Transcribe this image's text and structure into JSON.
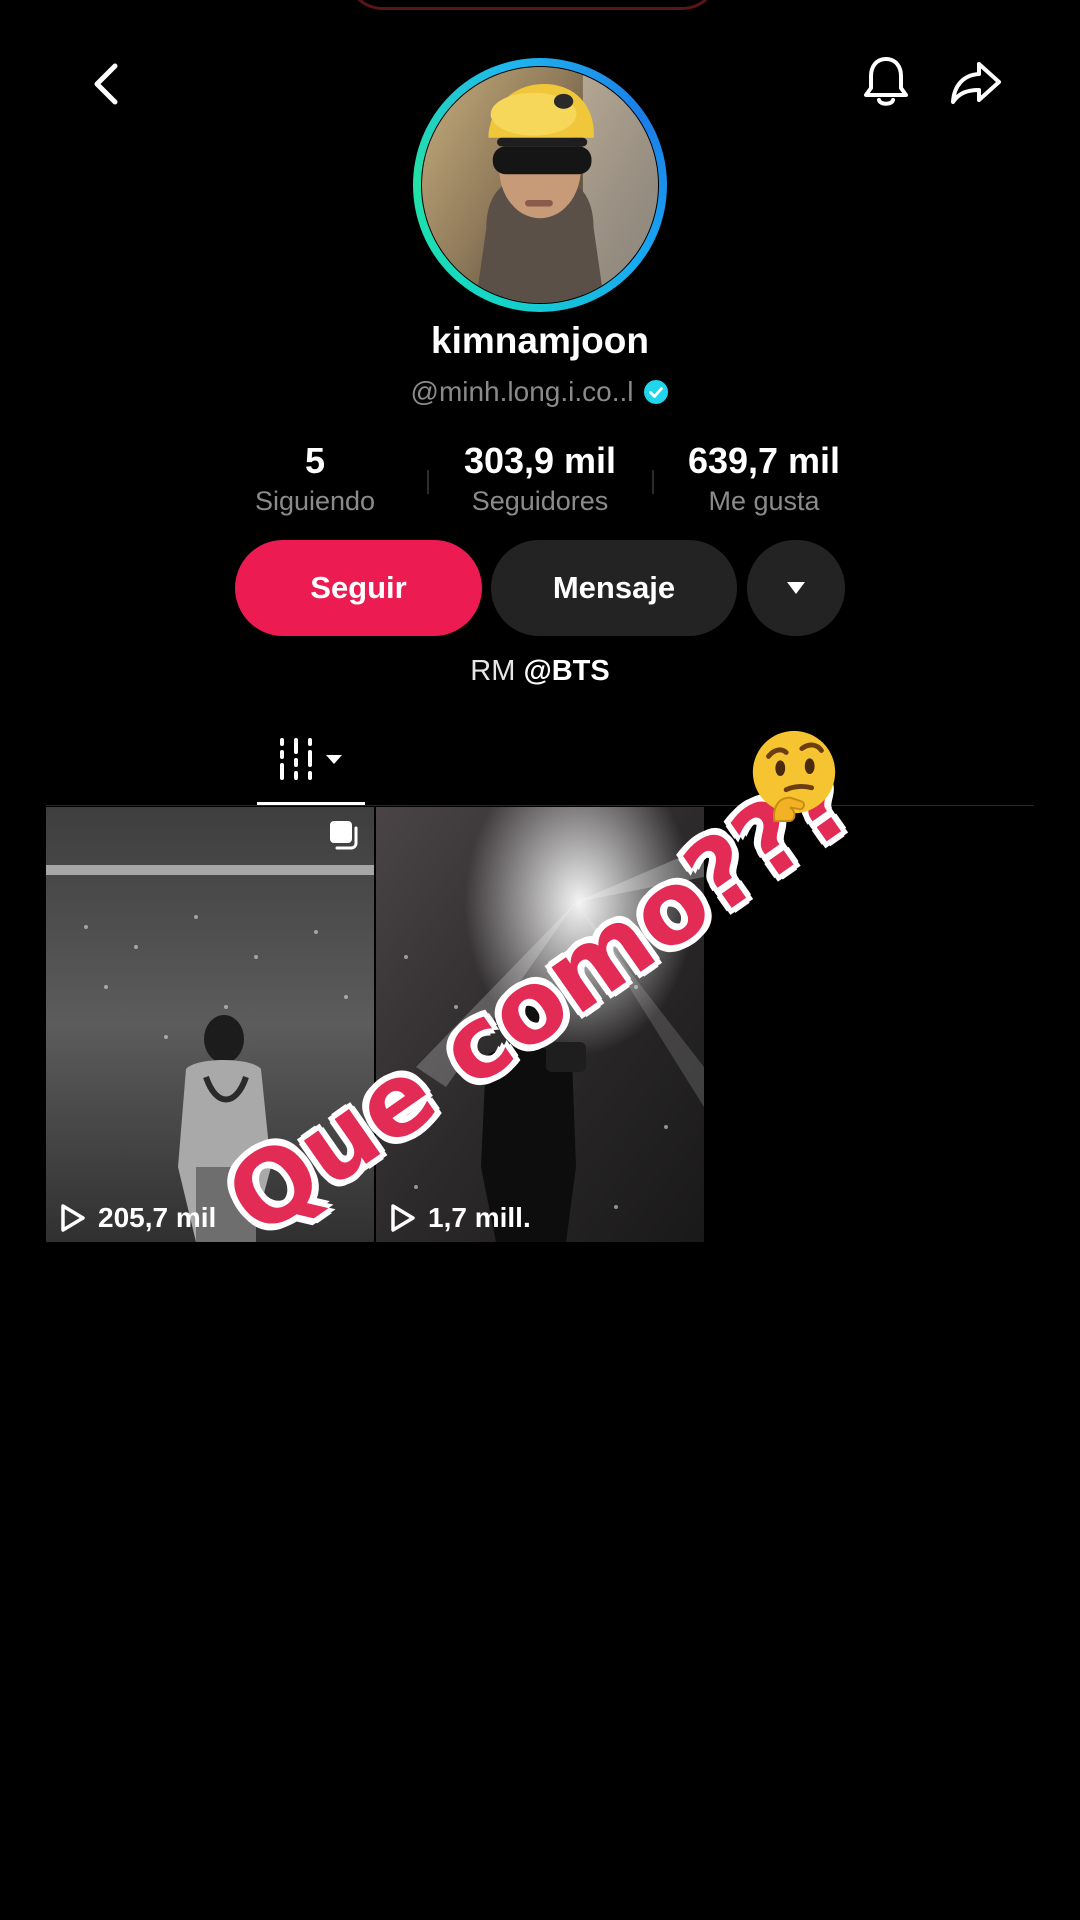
{
  "profile": {
    "display_name": "kimnamjoon",
    "handle": "@minh.long.i.co..l",
    "verified": true,
    "bio_prefix": "RM",
    "bio_mention": "@BTS"
  },
  "stats": [
    {
      "value": "5",
      "label": "Siguiendo"
    },
    {
      "value": "303,9 mil",
      "label": "Seguidores"
    },
    {
      "value": "639,7 mil",
      "label": "Me gusta"
    }
  ],
  "actions": {
    "follow_label": "Seguir",
    "message_label": "Mensaje"
  },
  "icons": {
    "back": "chevron-left-icon",
    "notifications": "bell-icon",
    "share": "share-arrow-icon",
    "more": "caret-down-icon",
    "videos_tab": "grid-bars-icon",
    "views": "play-icon",
    "multi_photo": "stack-icon"
  },
  "videos": [
    {
      "views": "205,7 mil"
    },
    {
      "views": "1,7 mill."
    }
  ],
  "overlay": {
    "caption": "Que como???",
    "emoji": "thinking-face"
  },
  "colors": {
    "follow_button": "#ec1b52",
    "secondary_button": "#232323",
    "verified_badge": "#20d5ec",
    "overlay_text": "#e22b55"
  }
}
